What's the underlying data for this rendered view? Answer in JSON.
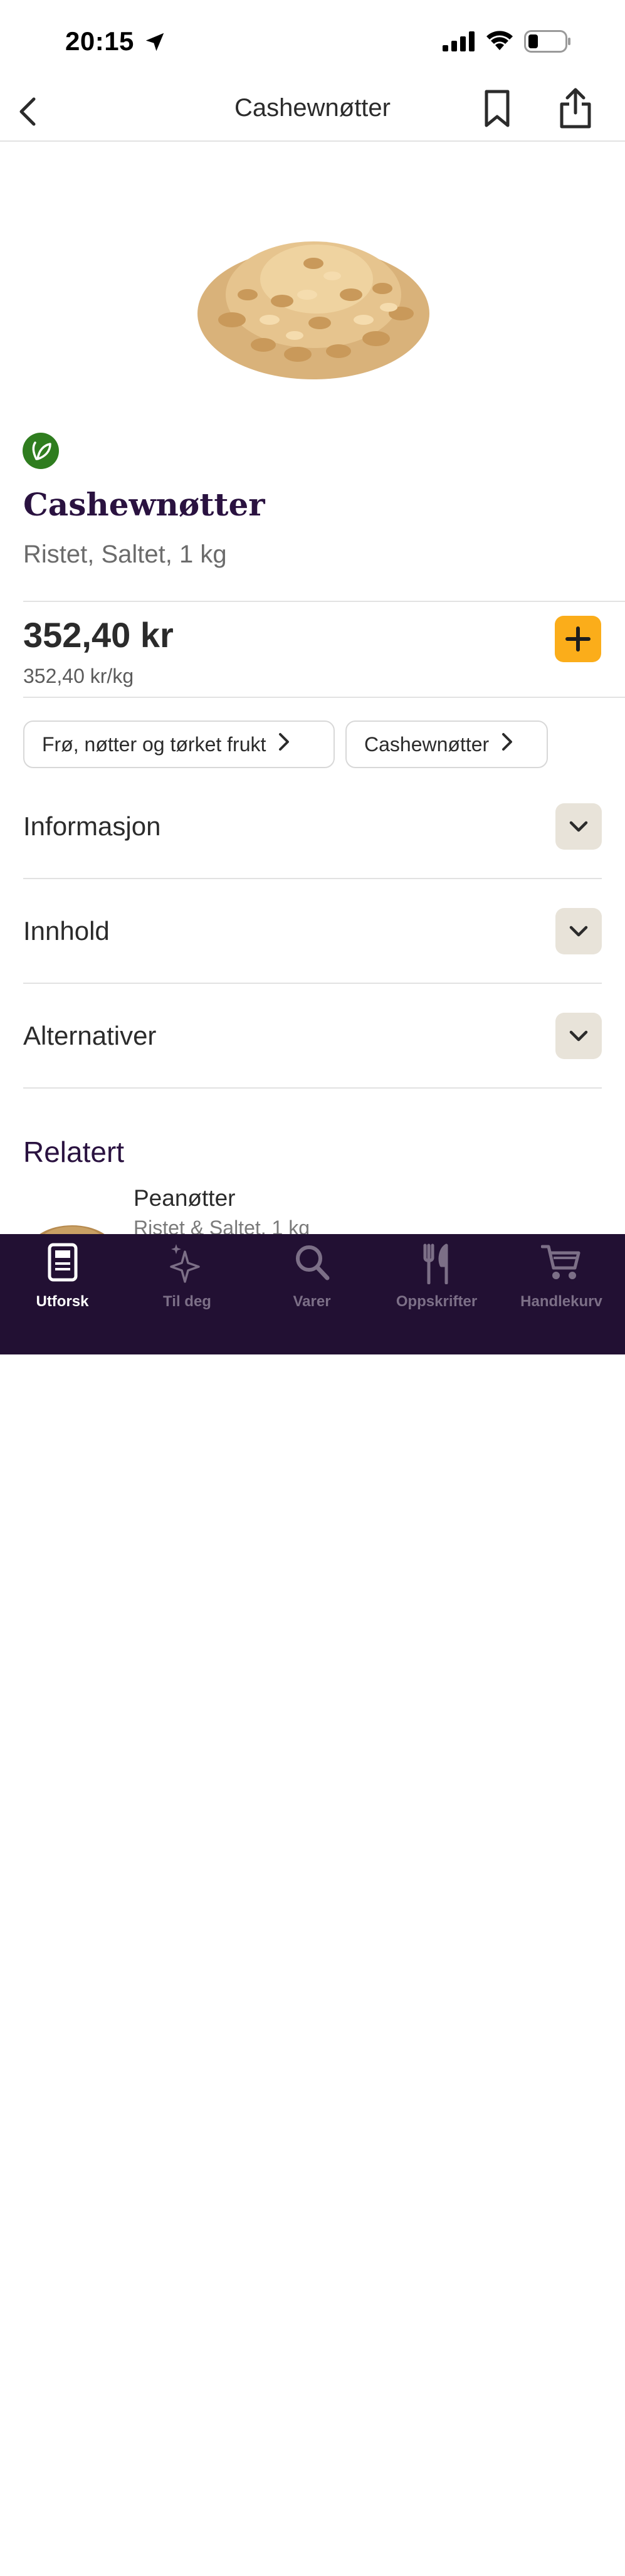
{
  "status_bar": {
    "time": "20:15"
  },
  "navbar": {
    "title": "Cashewnøtter"
  },
  "product": {
    "title": "Cashewnøtter",
    "subtitle": "Ristet, Saltet, 1 kg",
    "price": "352,40 kr",
    "unit_price": "352,40 kr/kg",
    "badge_icon": "leaf-icon",
    "badge_color": "#2f7d1f"
  },
  "categories": [
    {
      "label": "Frø, nøtter og tørket frukt"
    },
    {
      "label": "Cashewnøtter"
    }
  ],
  "accordions": [
    {
      "label": "Informasjon"
    },
    {
      "label": "Innhold"
    },
    {
      "label": "Alternativer"
    }
  ],
  "related": {
    "heading": "Relatert",
    "items": [
      {
        "name": "Peanøtter",
        "subtitle": "Ristet & Saltet, 1 kg"
      }
    ]
  },
  "tabbar": {
    "active": "Utforsk",
    "tabs": [
      {
        "label": "Utforsk",
        "icon": "book-icon"
      },
      {
        "label": "Til deg",
        "icon": "sparkle-icon"
      },
      {
        "label": "Varer",
        "icon": "search-icon"
      },
      {
        "label": "Oppskrifter",
        "icon": "fork-knife-icon"
      },
      {
        "label": "Handlekurv",
        "icon": "cart-icon"
      }
    ]
  },
  "colors": {
    "brand_dark": "#221033",
    "title_purple": "#2a1240",
    "add_button": "#fbad1a",
    "accordion_toggle": "#e8e3d9"
  }
}
